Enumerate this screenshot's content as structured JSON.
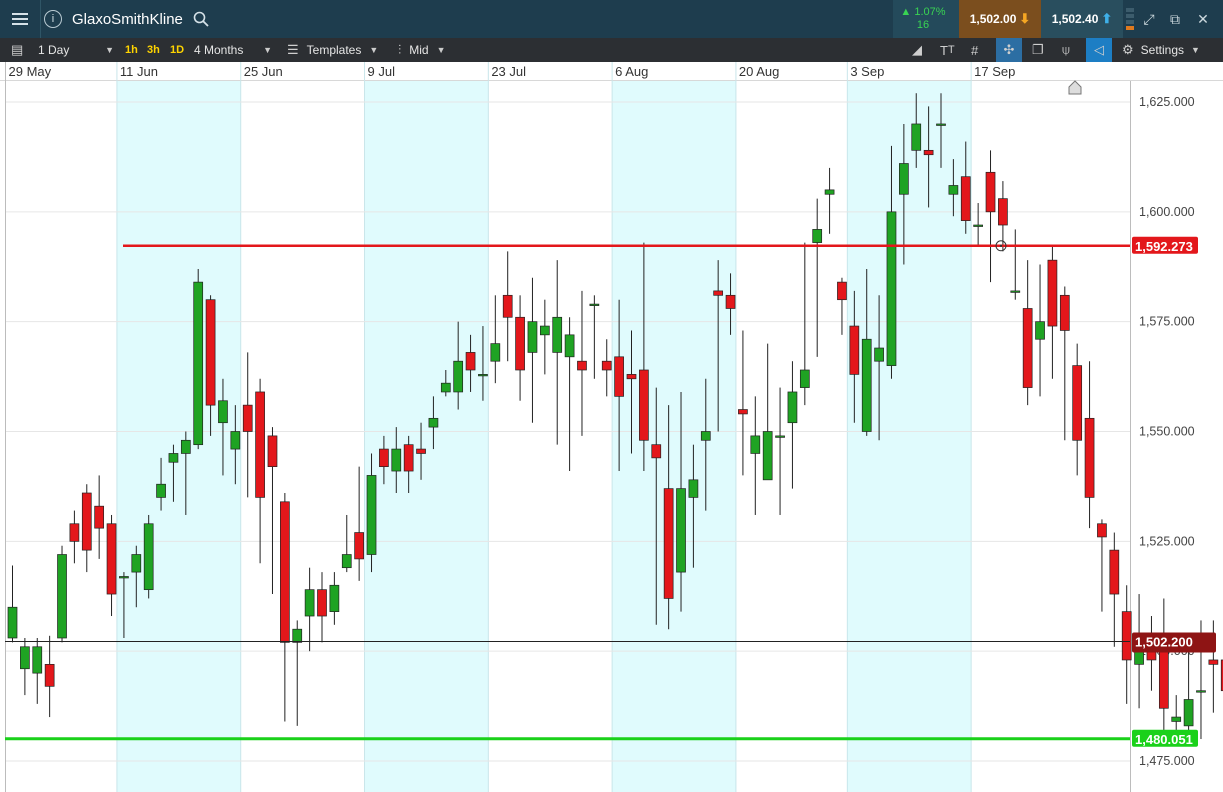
{
  "header": {
    "instrument": "GlaxoSmithKline",
    "change_pct": "▲ 1.07%",
    "change_points": "16",
    "sell_price": "1,502.00",
    "buy_price": "1,502.40"
  },
  "toolbar": {
    "timeframe": "1 Day",
    "quick_intervals": [
      "1h",
      "3h",
      "1D"
    ],
    "range": "4 Months",
    "templates": "Templates",
    "price_mode": "Mid",
    "settings": "Settings"
  },
  "colors": {
    "up": "#1fa323",
    "down": "#e3171b",
    "resistance": "#e3171b",
    "support": "#1ad11a",
    "shade": "#e0fbfd"
  },
  "chart_data": {
    "type": "candlestick",
    "x_labels": [
      {
        "label": "29 May",
        "index": 0
      },
      {
        "label": "11 Jun",
        "index": 9
      },
      {
        "label": "25 Jun",
        "index": 19
      },
      {
        "label": "9 Jul",
        "index": 29
      },
      {
        "label": "23 Jul",
        "index": 39
      },
      {
        "label": "6 Aug",
        "index": 49
      },
      {
        "label": "20 Aug",
        "index": 59
      },
      {
        "label": "3 Sep",
        "index": 68
      },
      {
        "label": "17 Sep",
        "index": 78
      }
    ],
    "y_ticks": [
      "1,625.000",
      "1,600.000",
      "1,575.000",
      "1,550.000",
      "1,525.000",
      "1,500.000",
      "1,475.000"
    ],
    "ylim": [
      1471,
      1630
    ],
    "horizontal_lines": [
      {
        "name": "resistance",
        "value": 1592.273,
        "label": "1,592.273"
      },
      {
        "name": "current",
        "value": 1502.2,
        "label": "1,502.200"
      },
      {
        "name": "support",
        "value": 1480.051,
        "label": "1,480.051"
      }
    ],
    "candles": [
      [
        1503,
        1510,
        1502,
        1519.5
      ],
      [
        1496,
        1501,
        1490,
        1503
      ],
      [
        1495,
        1501,
        1488,
        1503
      ],
      [
        1497,
        1492,
        1485,
        1503.5
      ],
      [
        1503,
        1522,
        1502,
        1524
      ],
      [
        1529,
        1525,
        1520,
        1532
      ],
      [
        1536,
        1523,
        1518,
        1538
      ],
      [
        1533,
        1528,
        1521,
        1540
      ],
      [
        1529,
        1513,
        1508,
        1531
      ],
      [
        1517,
        1517,
        1503,
        1518
      ],
      [
        1518,
        1522,
        1510,
        1524
      ],
      [
        1514,
        1529,
        1512,
        1531
      ],
      [
        1535,
        1538,
        1532,
        1544
      ],
      [
        1543,
        1545,
        1534,
        1547
      ],
      [
        1545,
        1548,
        1531,
        1550
      ],
      [
        1547,
        1584,
        1546,
        1587
      ],
      [
        1580,
        1556,
        1549,
        1581
      ],
      [
        1552,
        1557,
        1540,
        1562
      ],
      [
        1546,
        1550,
        1538,
        1556
      ],
      [
        1556,
        1550,
        1535,
        1568
      ],
      [
        1559,
        1535,
        1520,
        1562
      ],
      [
        1549,
        1542,
        1513,
        1551
      ],
      [
        1534,
        1502,
        1484,
        1536
      ],
      [
        1502,
        1505,
        1483,
        1507
      ],
      [
        1508,
        1514,
        1500,
        1519
      ],
      [
        1514,
        1508,
        1502,
        1518
      ],
      [
        1509,
        1515,
        1506,
        1518
      ],
      [
        1519,
        1522,
        1518,
        1531
      ],
      [
        1527,
        1521,
        1516,
        1542
      ],
      [
        1522,
        1540,
        1518,
        1545
      ],
      [
        1546,
        1542,
        1538,
        1549
      ],
      [
        1541,
        1546,
        1536,
        1551
      ],
      [
        1547,
        1541,
        1536,
        1549
      ],
      [
        1546,
        1545,
        1539,
        1552
      ],
      [
        1551,
        1553,
        1546,
        1558
      ],
      [
        1559,
        1561,
        1558,
        1564
      ],
      [
        1559,
        1566,
        1555,
        1575
      ],
      [
        1568,
        1564,
        1559,
        1572
      ],
      [
        1563,
        1563,
        1557,
        1574
      ],
      [
        1566,
        1570,
        1561,
        1581
      ],
      [
        1581,
        1576,
        1566,
        1591
      ],
      [
        1576,
        1564,
        1557,
        1581
      ],
      [
        1568,
        1575,
        1552,
        1585
      ],
      [
        1572,
        1574,
        1563,
        1580
      ],
      [
        1568,
        1576,
        1547,
        1589
      ],
      [
        1567,
        1572,
        1541,
        1576
      ],
      [
        1566,
        1564,
        1549,
        1582
      ],
      [
        1579,
        1579,
        1562,
        1581
      ],
      [
        1566,
        1564,
        1558,
        1571
      ],
      [
        1567,
        1558,
        1541,
        1580
      ],
      [
        1563,
        1562,
        1545,
        1573
      ],
      [
        1564,
        1548,
        1541,
        1593
      ],
      [
        1547,
        1544,
        1506,
        1560
      ],
      [
        1537,
        1512,
        1505,
        1556
      ],
      [
        1518,
        1537,
        1509,
        1559
      ],
      [
        1535,
        1539,
        1519,
        1547
      ],
      [
        1548,
        1550,
        1532,
        1562
      ],
      [
        1582,
        1581,
        1550,
        1589
      ],
      [
        1581,
        1578,
        1572,
        1586
      ],
      [
        1555,
        1554,
        1540,
        1573
      ],
      [
        1545,
        1549,
        1531,
        1558
      ],
      [
        1539,
        1550,
        1539,
        1570
      ],
      [
        1549,
        1549,
        1531,
        1560
      ],
      [
        1552,
        1559,
        1537,
        1566
      ],
      [
        1560,
        1564,
        1556,
        1593
      ],
      [
        1593,
        1596,
        1567,
        1603
      ],
      [
        1604,
        1605,
        1595,
        1610
      ],
      [
        1584,
        1580,
        1572,
        1585
      ],
      [
        1574,
        1563,
        1552,
        1582
      ],
      [
        1550,
        1571,
        1549,
        1587
      ],
      [
        1566,
        1569,
        1548,
        1581
      ],
      [
        1565,
        1600,
        1562,
        1615
      ],
      [
        1604,
        1611,
        1588,
        1620
      ],
      [
        1614,
        1620,
        1610,
        1627
      ],
      [
        1614,
        1613,
        1601,
        1624
      ],
      [
        1620,
        1620,
        1610,
        1627
      ],
      [
        1604,
        1606,
        1599,
        1612
      ],
      [
        1608,
        1598,
        1595,
        1616
      ],
      [
        1597,
        1597,
        1592,
        1602
      ],
      [
        1609,
        1600,
        1584,
        1614
      ],
      [
        1603,
        1597,
        1591,
        1607
      ],
      [
        1582,
        1582,
        1580,
        1596
      ],
      [
        1578,
        1560,
        1556,
        1589
      ],
      [
        1571,
        1575,
        1558,
        1588
      ],
      [
        1589,
        1574,
        1562,
        1592
      ],
      [
        1581,
        1573,
        1548,
        1583
      ],
      [
        1565,
        1548,
        1540,
        1570
      ],
      [
        1553,
        1535,
        1528,
        1566
      ],
      [
        1529,
        1526,
        1509,
        1530
      ],
      [
        1523,
        1513,
        1501,
        1527
      ],
      [
        1509,
        1498,
        1488,
        1515
      ],
      [
        1497,
        1501,
        1487,
        1513
      ],
      [
        1503,
        1498,
        1491,
        1508
      ],
      [
        1500,
        1487,
        1482,
        1512
      ],
      [
        1484,
        1485,
        1481,
        1490
      ],
      [
        1483,
        1489,
        1479,
        1500
      ],
      [
        1491,
        1491,
        1480,
        1507
      ],
      [
        1498,
        1497,
        1486,
        1507
      ],
      [
        1498,
        1491,
        1485,
        1502
      ],
      [
        1498,
        1493,
        1481,
        1513
      ],
      [
        1506,
        1502,
        1492,
        1511
      ],
      [
        1496,
        1509,
        1495,
        1514
      ]
    ]
  }
}
